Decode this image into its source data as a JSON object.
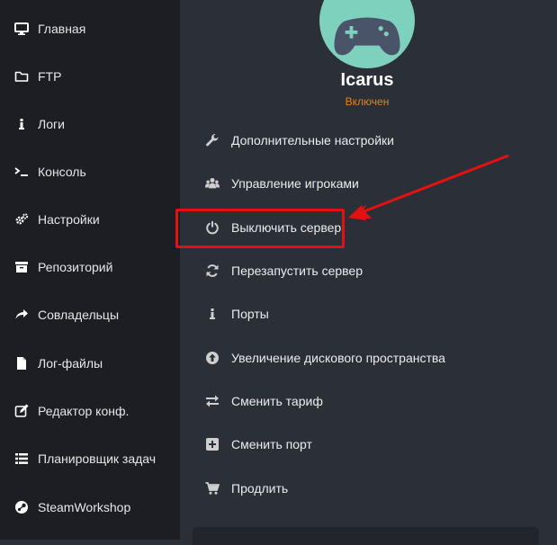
{
  "sidebar": {
    "items": [
      {
        "label": "Главная",
        "icon": "monitor-icon"
      },
      {
        "label": "FTP",
        "icon": "folder-icon"
      },
      {
        "label": "Логи",
        "icon": "info-icon"
      },
      {
        "label": "Консоль",
        "icon": "terminal-icon"
      },
      {
        "label": "Настройки",
        "icon": "gears-icon"
      },
      {
        "label": "Репозиторий",
        "icon": "archive-icon"
      },
      {
        "label": "Совладельцы",
        "icon": "share-icon"
      },
      {
        "label": "Лог-файлы",
        "icon": "file-icon"
      },
      {
        "label": "Редактор конф.",
        "icon": "edit-icon"
      },
      {
        "label": "Планировщик задач",
        "icon": "list-icon"
      },
      {
        "label": "SteamWorkshop",
        "icon": "steam-icon"
      }
    ]
  },
  "server": {
    "name": "Icarus",
    "status": "Включен",
    "avatar_icon": "gamepad-icon",
    "avatar_color": "#7ed1bd",
    "status_color": "#e0861a"
  },
  "actions": [
    {
      "label": "Дополнительные настройки",
      "icon": "wrench-icon"
    },
    {
      "label": "Управление игроками",
      "icon": "users-icon"
    },
    {
      "label": "Выключить сервер",
      "icon": "power-icon"
    },
    {
      "label": "Перезапустить сервер",
      "icon": "refresh-icon"
    },
    {
      "label": "Порты",
      "icon": "info-icon"
    },
    {
      "label": "Увеличение дискового пространства",
      "icon": "upload-circle-icon"
    },
    {
      "label": "Сменить тариф",
      "icon": "exchange-icon"
    },
    {
      "label": "Сменить порт",
      "icon": "plus-square-icon"
    },
    {
      "label": "Продлить",
      "icon": "cart-icon"
    }
  ],
  "annotation": {
    "color": "#e51010",
    "target": "Выключить сервер"
  }
}
